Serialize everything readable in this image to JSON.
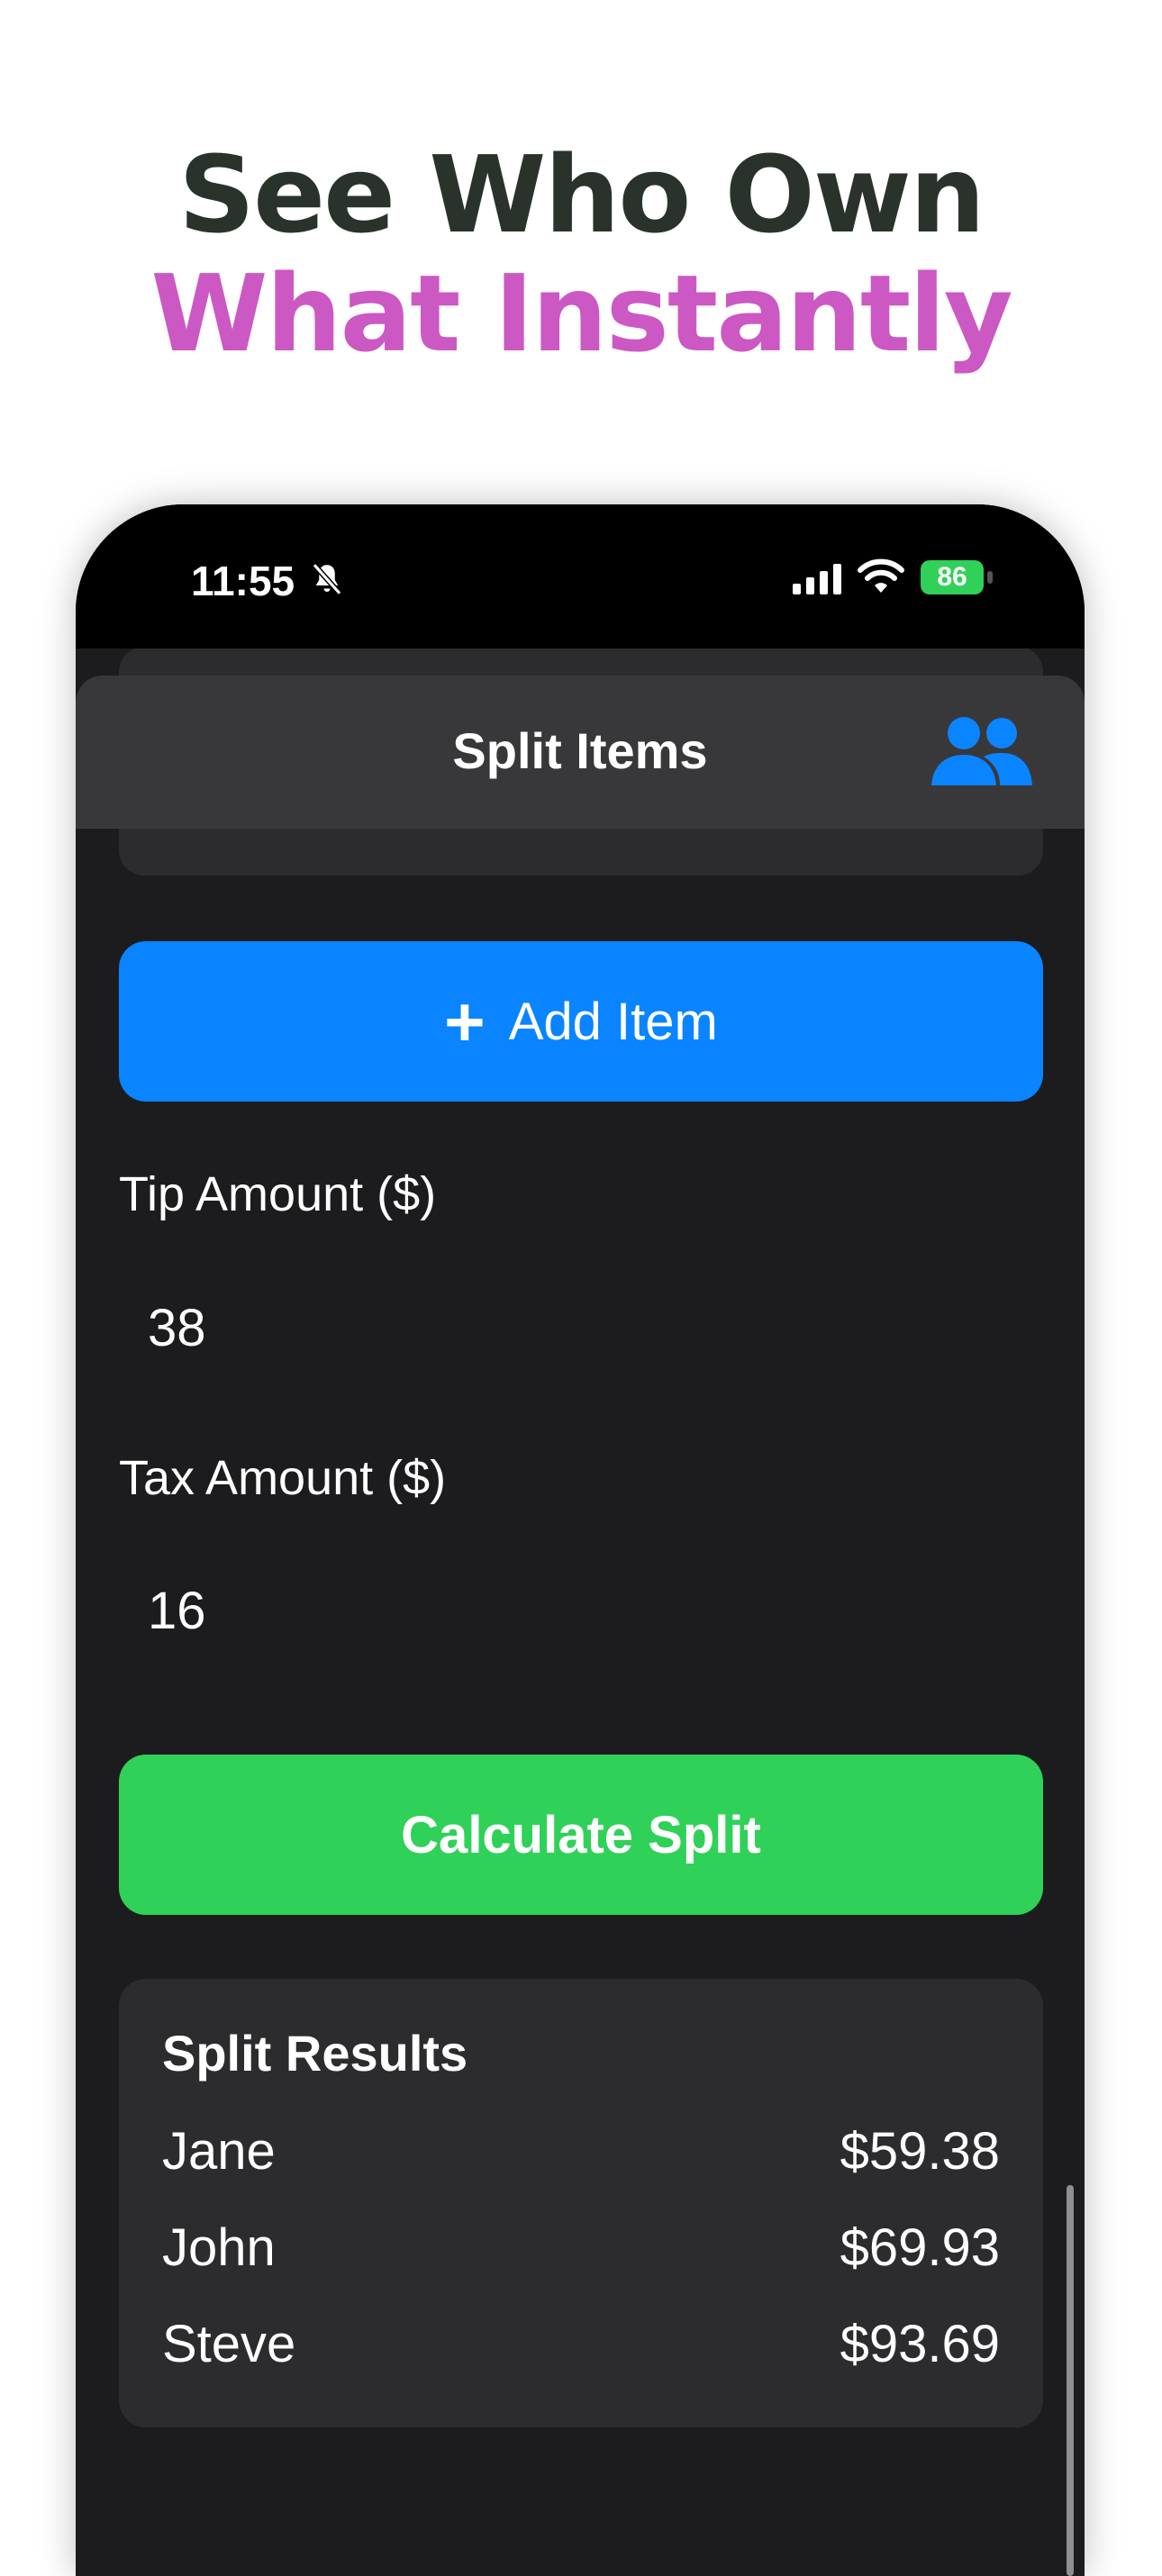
{
  "promo": {
    "line1": "See Who Own",
    "line2": "What Instantly",
    "line1_color": "#29332c",
    "line2_color": "#cc58c3"
  },
  "status_bar": {
    "time": "11:55",
    "battery": "86",
    "icons": [
      "bell-slash-icon",
      "cellular-signal-icon",
      "wifi-icon",
      "battery-charging-icon"
    ]
  },
  "nav": {
    "title": "Split Items",
    "people_icon": "people-icon"
  },
  "actions": {
    "add_item_label": "Add Item",
    "add_item_icon": "plus-icon",
    "calculate_label": "Calculate Split"
  },
  "fields": {
    "tip": {
      "label": "Tip Amount ($)",
      "value": "38"
    },
    "tax": {
      "label": "Tax Amount ($)",
      "value": "16"
    }
  },
  "results": {
    "title": "Split Results",
    "rows": [
      {
        "name": "Jane",
        "amount": "$59.38"
      },
      {
        "name": "John",
        "amount": "$69.93"
      },
      {
        "name": "Steve",
        "amount": "$93.69"
      }
    ]
  },
  "colors": {
    "accent_blue": "#0a84ff",
    "accent_green": "#30d158",
    "background": "#1c1c1e"
  }
}
